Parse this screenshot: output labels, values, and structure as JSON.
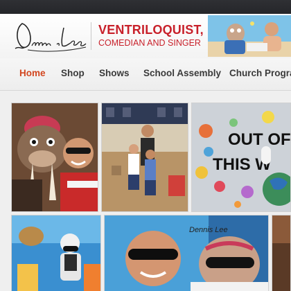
{
  "header": {
    "signature_text": "Dennis Lee",
    "tagline_line1": "VENTRILOQUIST,",
    "tagline_line2": "COMEDIAN AND SINGER"
  },
  "nav": {
    "active": "Home",
    "items": [
      {
        "label": "Home"
      },
      {
        "label": "Shop"
      },
      {
        "label": "Shows"
      },
      {
        "label": "School Assembly"
      },
      {
        "label": "Church Program"
      }
    ]
  },
  "gallery": {
    "tiles": [
      {
        "name": "walrus-puppet-photo"
      },
      {
        "name": "gym-kids-photo"
      },
      {
        "name": "out-of-this-world-board-photo",
        "board_text_1": "OUT OF",
        "board_text_2": "THIS W"
      },
      {
        "name": "stage-puppet-photo"
      },
      {
        "name": "sunglasses-puppet-photo",
        "shirt_text": "Dennis Lee"
      },
      {
        "name": "edge-photo"
      }
    ]
  },
  "colors": {
    "brand_red": "#c8202a",
    "nav_active": "#d2451e",
    "nav_text": "#3a3a3a"
  }
}
